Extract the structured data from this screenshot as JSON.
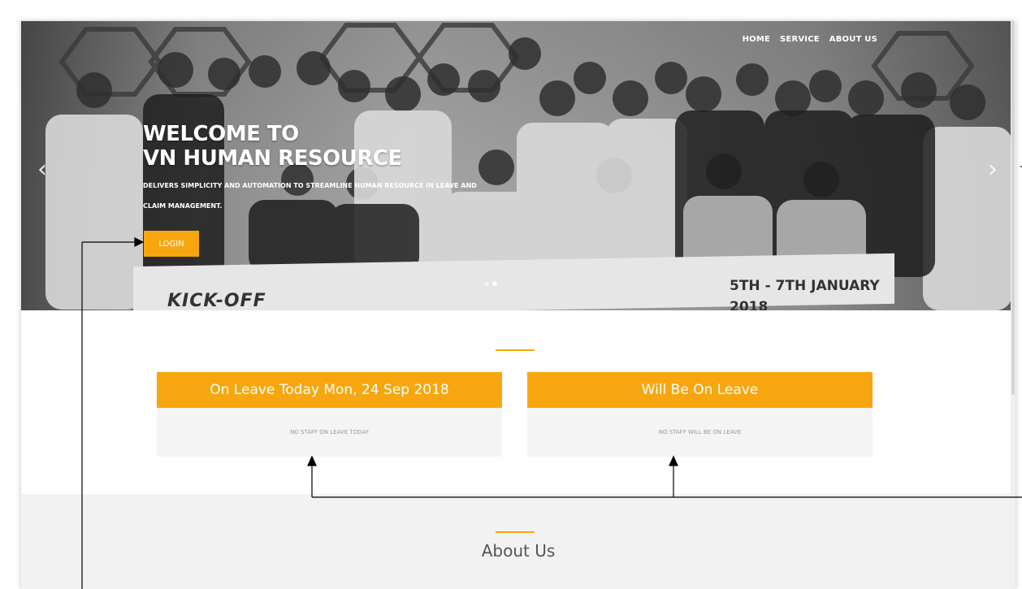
{
  "nav": {
    "home": "HOME",
    "service": "SERVICE",
    "about": "ABOUT US"
  },
  "hero": {
    "title_line1": "WELCOME TO",
    "title_line2": "VN HUMAN RESOURCE",
    "subtitle": "DELIVERS SIMPLICITY AND AUTOMATION TO STREAMLINE HUMAN RESOURCE IN LEAVE AND CLAIM MANAGEMENT.",
    "login_label": "LOGIN",
    "prev_glyph": "‹",
    "next_glyph": "›",
    "banner_left": "KICK-OFF",
    "banner_right": "5TH - 7TH JANUARY",
    "banner_year": "2018"
  },
  "panels": {
    "today": {
      "title": "On Leave Today Mon, 24 Sep 2018",
      "empty": "NO STAFF ON LEAVE TODAY"
    },
    "upcoming": {
      "title": "Will Be On Leave",
      "empty": "NO STAFF WILL BE ON LEAVE"
    }
  },
  "about": {
    "title": "About Us"
  },
  "colors": {
    "accent": "#f6a70f"
  }
}
